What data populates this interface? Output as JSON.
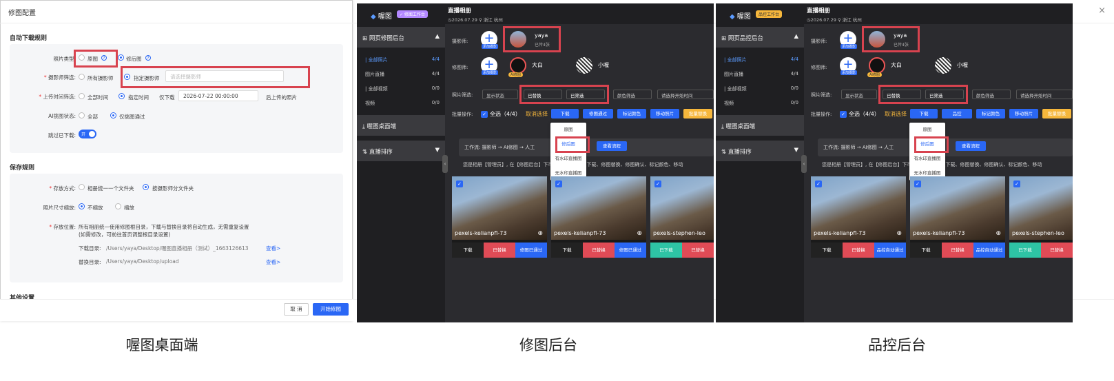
{
  "p1": {
    "title": "修图配置",
    "close": "×",
    "sec1": "自动下载规则",
    "photo_type": "照片类型:",
    "orig": "原图",
    "edited": "修后图",
    "photographer": "摄影师筛选:",
    "all_ph": "所有摄影师",
    "spec_ph": "指定摄影师",
    "ph_placeholder": "请选择摄影师",
    "upload": "上传时间筛选:",
    "all_time": "全部时间",
    "spec_time": "指定时间",
    "only": "仅下载",
    "date": "2026-07-22 00:00:00",
    "after": "后上传的照片",
    "ai": "AI挑图状态:",
    "ai_all": "全部",
    "ai_pass": "仅挑图通过",
    "skip": "跳过已下载:",
    "toggle": "开",
    "sec2": "保存规则",
    "store": "存放方式:",
    "store1": "相册统一一个文件夹",
    "store2": "按摄影师分文件夹",
    "resize": "照片尺寸缩放:",
    "noscale": "不缩放",
    "scale": "缩放",
    "loc": "存放位置:",
    "loc_desc1": "所有相册统一使用修图根目录，下载与替换目录将自动生成，无需重复设置",
    "loc_desc2": "(如需修改，可前往首页调整根目录设置)",
    "dl_dir": "下载目录:",
    "dl_path": "/Users/yaya/Desktop/喔图直播相册（测试）_1663126613",
    "rep_dir": "替换目录:",
    "rep_path": "/Users/yaya/Desktop/upload",
    "view": "查看>",
    "sec3": "其他设置",
    "cancel": "取 消",
    "start": "开始修图"
  },
  "p2": {
    "logo": "喔图",
    "badge": "✓ 修图工作台",
    "menu1": "网页修图后台",
    "footer": "修图后台"
  },
  "p3": {
    "logo": "喔图",
    "badge": "品控工作台",
    "menu1": "网页品控后台",
    "footer": "品控后台"
  },
  "common": {
    "items": [
      {
        "l": "| 全部照片",
        "c": "4/4"
      },
      {
        "l": "图片直播",
        "c": "4/4"
      },
      {
        "l": "| 全部视频",
        "c": "0/0"
      },
      {
        "l": "视频",
        "c": "0/0"
      }
    ],
    "menu2": "喔图桌面端",
    "menu3": "直播排序",
    "title": "直播相册",
    "meta": "◷2026.07.29  ⚲ 浙江 杭州",
    "ph_label": "摄影师:",
    "edit_label": "修图师:",
    "add": "添加摄影",
    "yaya": "yaya",
    "yaya_sub": "已传4张",
    "dabai": "大白",
    "ai_tag": "AI修图",
    "xiaowo": "小喔",
    "filter": "照片筛选:",
    "show_status": "显示状态",
    "replaced": "已替换",
    "filtered": "已筛选",
    "color": "颜色筛选",
    "time": "请选择开始时间",
    "batch": "批量操作:",
    "select_all": "全选（4/4）",
    "cancel_sel": "取消选择",
    "download": "下载",
    "pass": "修图通过",
    "qc": "品控",
    "mark": "标记颜色",
    "move": "移动照片",
    "batch_rep": "批量替换",
    "dd": [
      "原图",
      "修后图",
      "有水印直播图",
      "无水印直播图"
    ],
    "flow": "工作流: 摄影师 → AI修图 → 人工",
    "flow_btn": "查看流程",
    "note": "您是相册【管理员】, 在【修图后台】下可进行全部操作（下载、修图替换、修图确认、标记颜色、移动",
    "cards": [
      {
        "name": "pexels-kelianpfl-73"
      },
      {
        "name": "pexels-kelianpfl-73"
      },
      {
        "name": "pexels-stephen-leo"
      }
    ],
    "downloaded": "已下载",
    "rep": "已替换",
    "pass_done": "修图已通过",
    "qc_done": "品控自动通过"
  },
  "p1_footer": "喔图桌面端"
}
